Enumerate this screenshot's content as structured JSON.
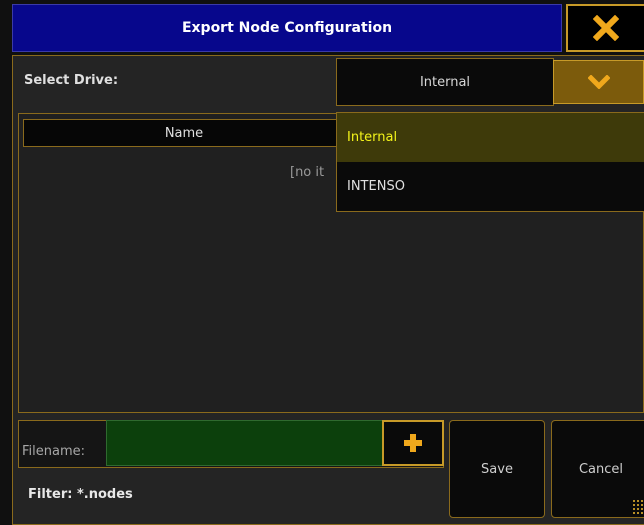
{
  "dialog": {
    "title": "Export Node Configuration",
    "select_drive_label": "Select Drive:",
    "selected_drive": "Internal"
  },
  "list": {
    "column_name": "Name",
    "empty_text": "[no it"
  },
  "dropdown": {
    "options": [
      {
        "label": "Internal",
        "selected": true
      },
      {
        "label": "INTENSO",
        "selected": false
      }
    ]
  },
  "footer": {
    "filename_label": "Filename:",
    "filename_value": "",
    "filter_text": "Filter: *.nodes",
    "save_label": "Save",
    "cancel_label": "Cancel"
  },
  "icons": {
    "close": "close-icon",
    "dropdown": "chevron-down-icon",
    "add": "plus-icon",
    "resize": "resize-grip-icon"
  },
  "colors": {
    "title_bar": "#07078c",
    "accent": "#c79a28",
    "selected_option_text": "#f4f41a",
    "filename_field": "#0c400c"
  }
}
